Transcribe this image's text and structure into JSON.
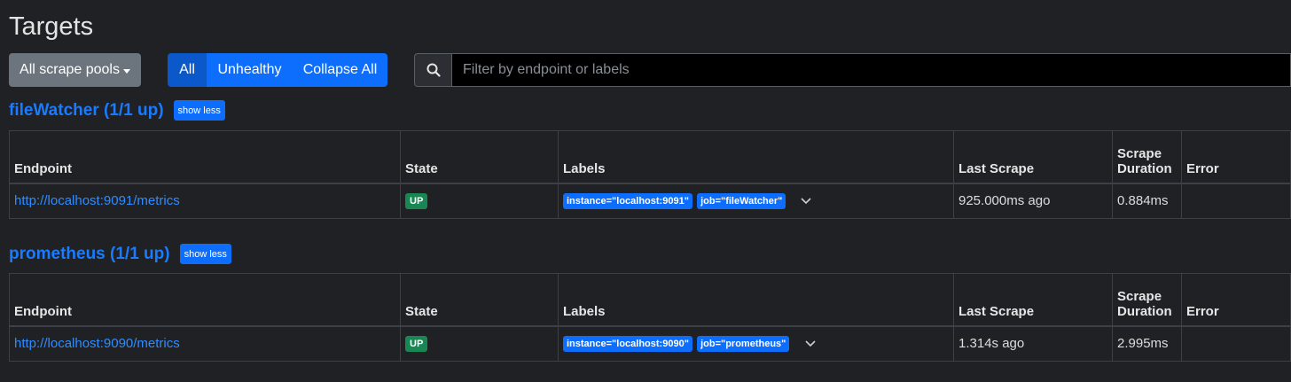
{
  "page": {
    "title": "Targets"
  },
  "toolbar": {
    "pool_select": "All scrape pools",
    "filter_all": "All",
    "filter_unhealthy": "Unhealthy",
    "collapse_all": "Collapse All",
    "search_placeholder": "Filter by endpoint or labels",
    "search_value": ""
  },
  "table_headers": {
    "endpoint": "Endpoint",
    "state": "State",
    "labels": "Labels",
    "last_scrape": "Last Scrape",
    "scrape_duration": "Scrape Duration",
    "error": "Error"
  },
  "pools": [
    {
      "title": "fileWatcher (1/1 up)",
      "toggle": "show less",
      "rows": [
        {
          "endpoint": "http://localhost:9091/metrics",
          "state": "UP",
          "labels": [
            "instance=\"localhost:9091\"",
            "job=\"fileWatcher\""
          ],
          "last_scrape": "925.000ms ago",
          "scrape_duration": "0.884ms",
          "error": ""
        }
      ]
    },
    {
      "title": "prometheus (1/1 up)",
      "toggle": "show less",
      "rows": [
        {
          "endpoint": "http://localhost:9090/metrics",
          "state": "UP",
          "labels": [
            "instance=\"localhost:9090\"",
            "job=\"prometheus\""
          ],
          "last_scrape": "1.314s ago",
          "scrape_duration": "2.995ms",
          "error": ""
        }
      ]
    }
  ],
  "colors": {
    "background": "#1f2125",
    "primary": "#0d6efd",
    "success": "#198754",
    "secondary": "#6c757d"
  },
  "icons": {
    "search": "search-icon",
    "dropdown": "caret-down-icon",
    "expand": "chevron-down-icon"
  }
}
